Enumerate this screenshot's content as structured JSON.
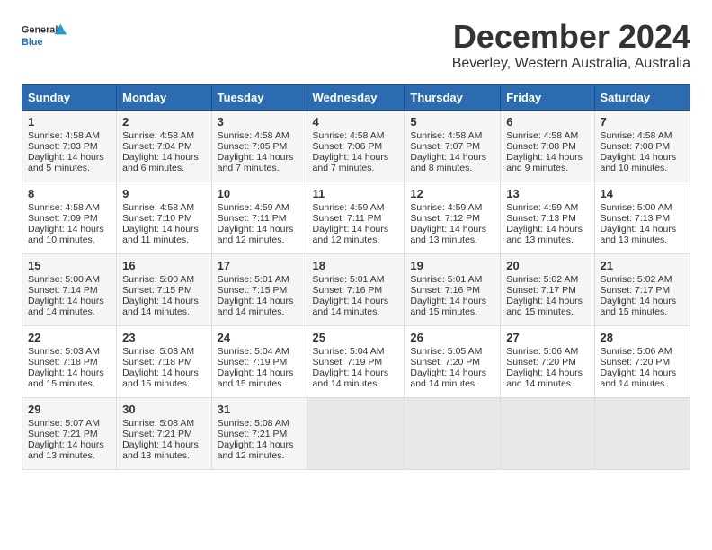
{
  "logo": {
    "line1": "General",
    "line2": "Blue"
  },
  "title": "December 2024",
  "subtitle": "Beverley, Western Australia, Australia",
  "days_of_week": [
    "Sunday",
    "Monday",
    "Tuesday",
    "Wednesday",
    "Thursday",
    "Friday",
    "Saturday"
  ],
  "weeks": [
    [
      {
        "num": "1",
        "sunrise": "4:58 AM",
        "sunset": "7:03 PM",
        "daylight": "14 hours and 5 minutes."
      },
      {
        "num": "2",
        "sunrise": "4:58 AM",
        "sunset": "7:04 PM",
        "daylight": "14 hours and 6 minutes."
      },
      {
        "num": "3",
        "sunrise": "4:58 AM",
        "sunset": "7:05 PM",
        "daylight": "14 hours and 7 minutes."
      },
      {
        "num": "4",
        "sunrise": "4:58 AM",
        "sunset": "7:06 PM",
        "daylight": "14 hours and 7 minutes."
      },
      {
        "num": "5",
        "sunrise": "4:58 AM",
        "sunset": "7:07 PM",
        "daylight": "14 hours and 8 minutes."
      },
      {
        "num": "6",
        "sunrise": "4:58 AM",
        "sunset": "7:08 PM",
        "daylight": "14 hours and 9 minutes."
      },
      {
        "num": "7",
        "sunrise": "4:58 AM",
        "sunset": "7:08 PM",
        "daylight": "14 hours and 10 minutes."
      }
    ],
    [
      {
        "num": "8",
        "sunrise": "4:58 AM",
        "sunset": "7:09 PM",
        "daylight": "14 hours and 10 minutes."
      },
      {
        "num": "9",
        "sunrise": "4:58 AM",
        "sunset": "7:10 PM",
        "daylight": "14 hours and 11 minutes."
      },
      {
        "num": "10",
        "sunrise": "4:59 AM",
        "sunset": "7:11 PM",
        "daylight": "14 hours and 12 minutes."
      },
      {
        "num": "11",
        "sunrise": "4:59 AM",
        "sunset": "7:11 PM",
        "daylight": "14 hours and 12 minutes."
      },
      {
        "num": "12",
        "sunrise": "4:59 AM",
        "sunset": "7:12 PM",
        "daylight": "14 hours and 13 minutes."
      },
      {
        "num": "13",
        "sunrise": "4:59 AM",
        "sunset": "7:13 PM",
        "daylight": "14 hours and 13 minutes."
      },
      {
        "num": "14",
        "sunrise": "5:00 AM",
        "sunset": "7:13 PM",
        "daylight": "14 hours and 13 minutes."
      }
    ],
    [
      {
        "num": "15",
        "sunrise": "5:00 AM",
        "sunset": "7:14 PM",
        "daylight": "14 hours and 14 minutes."
      },
      {
        "num": "16",
        "sunrise": "5:00 AM",
        "sunset": "7:15 PM",
        "daylight": "14 hours and 14 minutes."
      },
      {
        "num": "17",
        "sunrise": "5:01 AM",
        "sunset": "7:15 PM",
        "daylight": "14 hours and 14 minutes."
      },
      {
        "num": "18",
        "sunrise": "5:01 AM",
        "sunset": "7:16 PM",
        "daylight": "14 hours and 14 minutes."
      },
      {
        "num": "19",
        "sunrise": "5:01 AM",
        "sunset": "7:16 PM",
        "daylight": "14 hours and 15 minutes."
      },
      {
        "num": "20",
        "sunrise": "5:02 AM",
        "sunset": "7:17 PM",
        "daylight": "14 hours and 15 minutes."
      },
      {
        "num": "21",
        "sunrise": "5:02 AM",
        "sunset": "7:17 PM",
        "daylight": "14 hours and 15 minutes."
      }
    ],
    [
      {
        "num": "22",
        "sunrise": "5:03 AM",
        "sunset": "7:18 PM",
        "daylight": "14 hours and 15 minutes."
      },
      {
        "num": "23",
        "sunrise": "5:03 AM",
        "sunset": "7:18 PM",
        "daylight": "14 hours and 15 minutes."
      },
      {
        "num": "24",
        "sunrise": "5:04 AM",
        "sunset": "7:19 PM",
        "daylight": "14 hours and 15 minutes."
      },
      {
        "num": "25",
        "sunrise": "5:04 AM",
        "sunset": "7:19 PM",
        "daylight": "14 hours and 14 minutes."
      },
      {
        "num": "26",
        "sunrise": "5:05 AM",
        "sunset": "7:20 PM",
        "daylight": "14 hours and 14 minutes."
      },
      {
        "num": "27",
        "sunrise": "5:06 AM",
        "sunset": "7:20 PM",
        "daylight": "14 hours and 14 minutes."
      },
      {
        "num": "28",
        "sunrise": "5:06 AM",
        "sunset": "7:20 PM",
        "daylight": "14 hours and 14 minutes."
      }
    ],
    [
      {
        "num": "29",
        "sunrise": "5:07 AM",
        "sunset": "7:21 PM",
        "daylight": "14 hours and 13 minutes."
      },
      {
        "num": "30",
        "sunrise": "5:08 AM",
        "sunset": "7:21 PM",
        "daylight": "14 hours and 13 minutes."
      },
      {
        "num": "31",
        "sunrise": "5:08 AM",
        "sunset": "7:21 PM",
        "daylight": "14 hours and 12 minutes."
      },
      null,
      null,
      null,
      null
    ]
  ]
}
